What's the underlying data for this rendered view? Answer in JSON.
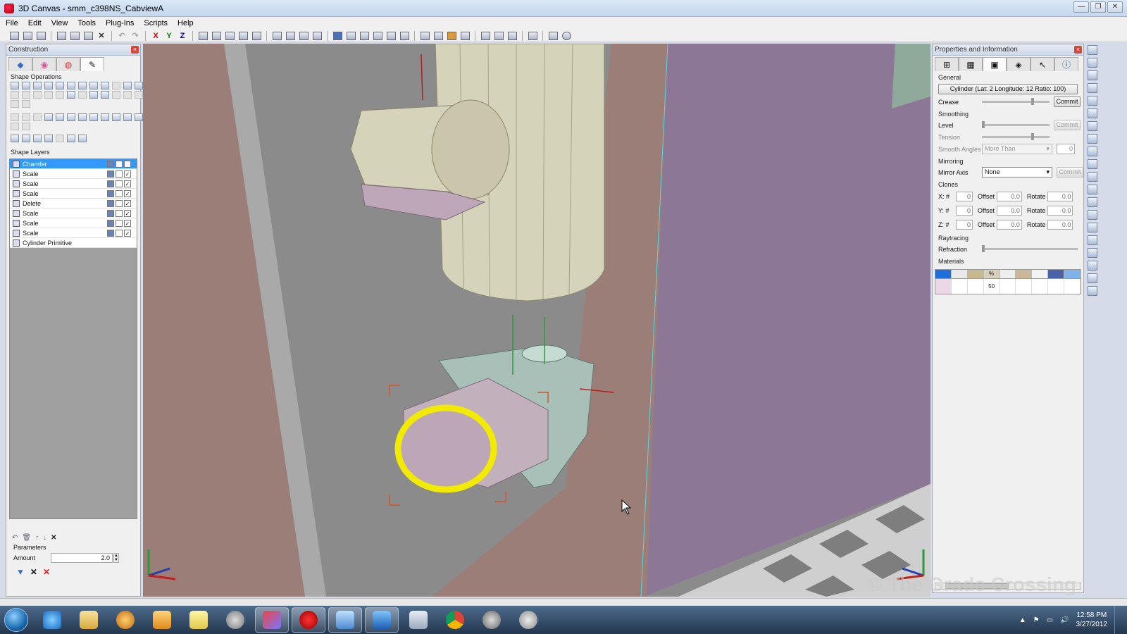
{
  "window": {
    "title": "3D Canvas - smm_c398NS_CabviewA",
    "controls": [
      "—",
      "❐",
      "✕"
    ]
  },
  "menu": [
    "File",
    "Edit",
    "View",
    "Tools",
    "Plug-Ins",
    "Scripts",
    "Help"
  ],
  "toolbar": {
    "axis_x": "X",
    "axis_y": "Y",
    "axis_z": "Z"
  },
  "construction": {
    "title": "Construction",
    "tabs": [
      "◆",
      "◉",
      "◍",
      "✎"
    ],
    "shape_operations_label": "Shape Operations",
    "shape_layers_label": "Shape Layers",
    "layers": [
      {
        "name": "Chamfer",
        "selected": true
      },
      {
        "name": "Scale"
      },
      {
        "name": "Scale"
      },
      {
        "name": "Scale"
      },
      {
        "name": "Delete"
      },
      {
        "name": "Scale"
      },
      {
        "name": "Scale"
      },
      {
        "name": "Scale"
      },
      {
        "name": "Cylinder Primitive"
      }
    ],
    "parameters_label": "Parameters",
    "amount_label": "Amount",
    "amount_value": "2.0"
  },
  "properties": {
    "title": "Properties and Information",
    "general_label": "General",
    "shape_button": "Cylinder (Lat: 2  Longitude: 12  Ratio: 100)",
    "crease_label": "Crease",
    "commit_label": "Commit",
    "smoothing_label": "Smoothing",
    "level_label": "Level",
    "tension_label": "Tension",
    "smooth_angles_label": "Smooth Angles",
    "smooth_angles_value": "More Than",
    "smooth_angles_num": "0",
    "mirroring_label": "Mirroring",
    "mirror_axis_label": "Mirror Axis",
    "mirror_axis_value": "None",
    "clones_label": "Clones",
    "clone_rows": [
      {
        "axis": "X: #",
        "count": "0",
        "offset_label": "Offset",
        "offset": "0.0",
        "rotate_label": "Rotate",
        "rotate": "0.0"
      },
      {
        "axis": "Y: #",
        "count": "0",
        "offset_label": "Offset",
        "offset": "0.0",
        "rotate_label": "Rotate",
        "rotate": "0.0"
      },
      {
        "axis": "Z: #",
        "count": "0",
        "offset_label": "Offset",
        "offset": "0.0",
        "rotate_label": "Rotate",
        "rotate": "0.0"
      }
    ],
    "raytracing_label": "Raytracing",
    "refraction_label": "Refraction",
    "materials_label": "Materials",
    "material_headers": [
      "",
      "",
      "",
      "%",
      "",
      "",
      "",
      "",
      ""
    ],
    "material_values": [
      "",
      "",
      "",
      "50",
      "",
      "",
      "",
      "",
      ""
    ]
  },
  "taskbar": {
    "time": "12:58 PM",
    "date": "3/27/2012"
  },
  "watermark": "© The Grade Crossing",
  "colors": {
    "wall_purple": "#8c7796",
    "wall_brown": "#9b7e78",
    "floor_gray": "#8a8a8a",
    "cylinder_tan": "#d6d3bb",
    "selection_yellow": "#f2ea00",
    "bracket_teal": "#a8c0b8"
  }
}
